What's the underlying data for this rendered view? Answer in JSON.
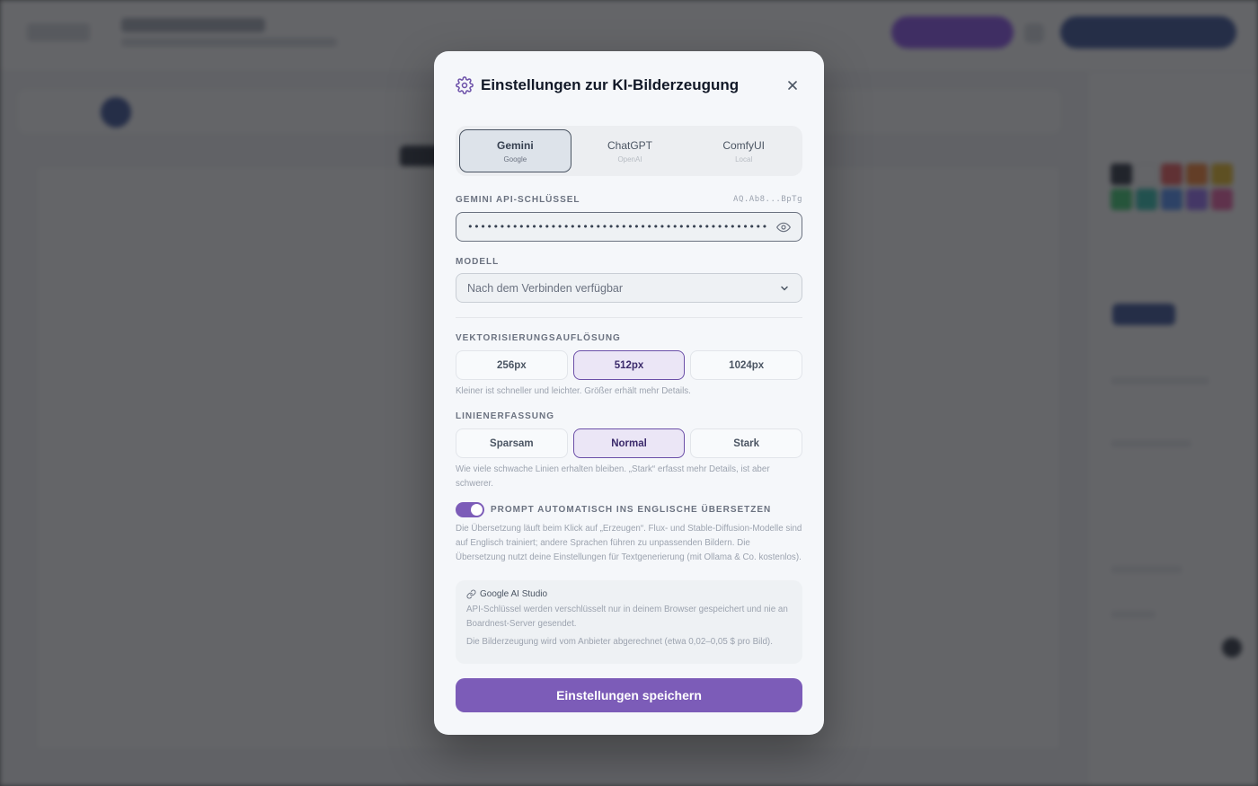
{
  "colors": {
    "accent": "#7c5cb8",
    "scrim": "#4a4c4e"
  },
  "modal": {
    "title": "Einstellungen zur KI-Bilderzeugung",
    "title_icon": "gear-icon",
    "close_icon": "close-icon"
  },
  "providers": [
    {
      "name": "Gemini",
      "sub": "Google",
      "active": true
    },
    {
      "name": "ChatGPT",
      "sub": "OpenAI",
      "active": false
    },
    {
      "name": "ComfyUI",
      "sub": "Local",
      "active": false
    }
  ],
  "api_key": {
    "label": "GEMINI API-SCHLÜSSEL",
    "hint": "AQ.Ab8...BpTg",
    "masked_value": "••••••••••••••••••••••••••••••••••••••••••••••••••",
    "reveal_icon": "eye-icon"
  },
  "model": {
    "label": "MODELL",
    "value": "Nach dem Verbinden verfügbar",
    "chevron_icon": "chevron-down-icon"
  },
  "resolution": {
    "label": "VEKTORISIERUNGSAUFLÖSUNG",
    "options": [
      "256px",
      "512px",
      "1024px"
    ],
    "selected": "512px",
    "help": "Kleiner ist schneller und leichter. Größer erhält mehr Details."
  },
  "line_detection": {
    "label": "LINIENERFASSUNG",
    "options": [
      "Sparsam",
      "Normal",
      "Stark"
    ],
    "selected": "Normal",
    "help": "Wie viele schwache Linien erhalten bleiben. „Stark“ erfasst mehr Details, ist aber schwerer."
  },
  "translate": {
    "label": "PROMPT AUTOMATISCH INS ENGLISCHE ÜBERSETZEN",
    "enabled": true,
    "help": "Die Übersetzung läuft beim Klick auf „Erzeugen“. Flux- und Stable-Diffusion-Modelle sind auf Englisch trainiert; andere Sprachen führen zu unpassenden Bildern. Die Übersetzung nutzt deine Einstellungen für Textgenerierung (mit Ollama & Co. kostenlos)."
  },
  "info": {
    "link_icon": "link-icon",
    "link_label": "Google AI Studio",
    "text1": "API-Schlüssel werden verschlüsselt nur in deinem Browser gespeichert und nie an Boardnest-Server gesendet.",
    "text2": "Die Bilderzeugung wird vom Anbieter abgerechnet (etwa 0,02–0,05 $ pro Bild)."
  },
  "save_label": "Einstellungen speichern"
}
